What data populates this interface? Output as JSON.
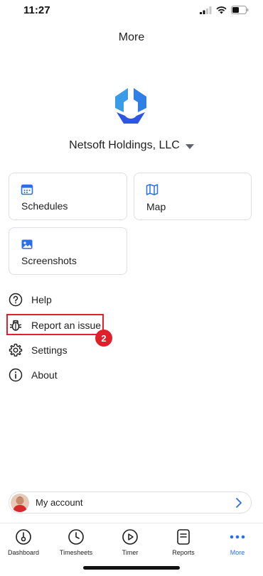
{
  "status_bar": {
    "time": "11:27"
  },
  "header": {
    "title": "More"
  },
  "organization": {
    "name": "Netsoft Holdings, LLC"
  },
  "cards": [
    {
      "label": "Schedules",
      "icon": "calendar-icon"
    },
    {
      "label": "Map",
      "icon": "map-icon"
    },
    {
      "label": "Screenshots",
      "icon": "image-icon"
    }
  ],
  "menu": [
    {
      "label": "Help",
      "icon": "help-icon"
    },
    {
      "label": "Report an issue",
      "icon": "bug-icon"
    },
    {
      "label": "Settings",
      "icon": "gear-icon"
    },
    {
      "label": "About",
      "icon": "info-icon"
    }
  ],
  "annotation": {
    "step": "2"
  },
  "account": {
    "label": "My account"
  },
  "tabs": [
    {
      "label": "Dashboard",
      "icon": "dashboard-icon"
    },
    {
      "label": "Timesheets",
      "icon": "clock-icon"
    },
    {
      "label": "Timer",
      "icon": "play-icon"
    },
    {
      "label": "Reports",
      "icon": "report-icon"
    },
    {
      "label": "More",
      "icon": "more-dots-icon",
      "active": true
    }
  ],
  "colors": {
    "accent": "#2a6fe8",
    "highlight": "#e0202b",
    "logo_light": "#3a9be8",
    "logo_dark": "#2f55e4"
  }
}
